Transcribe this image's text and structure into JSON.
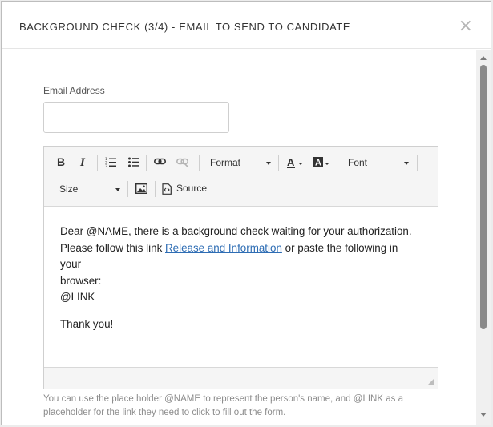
{
  "modal": {
    "title": "BACKGROUND CHECK (3/4) - EMAIL TO SEND TO CANDIDATE",
    "close_glyph": "×"
  },
  "form": {
    "email_label": "Email Address",
    "email_value": "  "
  },
  "toolbar": {
    "bold_icon": "bold-icon",
    "italic_icon": "italic-icon",
    "ordered_list_icon": "ordered-list-icon",
    "bulleted_list_icon": "bulleted-list-icon",
    "link_icon": "link-icon",
    "unlink_icon": "unlink-icon",
    "format_label": "Format",
    "text_color_icon": "text-color-icon",
    "bg_color_icon": "background-color-icon",
    "font_label": "Font",
    "size_label": "Size",
    "image_icon": "image-icon",
    "source_label": "Source"
  },
  "editor": {
    "line1": "Dear @NAME, there is a background check waiting for your authorization.",
    "line2_before": "Please follow this link ",
    "link_text": "Release and Information",
    "line2_after": " or paste the following in your",
    "line3": "browser:",
    "line4": "@LINK",
    "line5": "Thank you!"
  },
  "help_text": "You can use the place holder @NAME to represent the person's name, and @LINK as a placeholder for the link they need to click to fill out the form.",
  "colors": {
    "link": "#2e6db4",
    "toolbar_bg": "#f5f5f5",
    "border": "#cfcfcf"
  }
}
